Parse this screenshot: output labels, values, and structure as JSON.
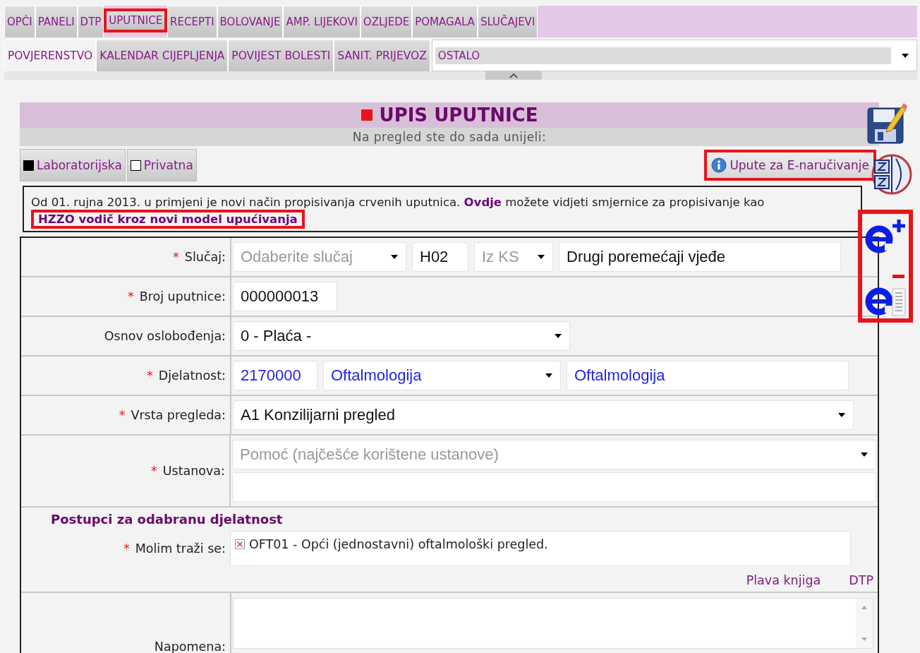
{
  "tabs_row_1": [
    {
      "label": "OPĆI",
      "selected": false,
      "highlighted": false
    },
    {
      "label": "PANELI",
      "selected": false,
      "highlighted": false
    },
    {
      "label": "DTP",
      "selected": false,
      "highlighted": false
    },
    {
      "label": "UPUTNICE",
      "selected": false,
      "highlighted": true
    },
    {
      "label": "RECEPTI",
      "selected": false,
      "highlighted": false
    },
    {
      "label": "BOLOVANJE",
      "selected": false,
      "highlighted": false
    },
    {
      "label": "AMP. LIJEKOVI",
      "selected": false,
      "highlighted": false
    },
    {
      "label": "OZLJEDE",
      "selected": false,
      "highlighted": false
    },
    {
      "label": "POMAGALA",
      "selected": false,
      "highlighted": false
    },
    {
      "label": "SLUČAJEVI",
      "selected": false,
      "highlighted": false
    }
  ],
  "tabs_row_2": [
    {
      "label": "POVJERENSTVO",
      "selected": true,
      "highlighted": false
    },
    {
      "label": "KALENDAR CIJEPLJENJA",
      "selected": false,
      "highlighted": false
    },
    {
      "label": "POVIJEST BOLESTI",
      "selected": false,
      "highlighted": false
    },
    {
      "label": "SANIT. PRIJEVOZ",
      "selected": false,
      "highlighted": false
    }
  ],
  "more_menu": {
    "value": "OSTALO"
  },
  "form": {
    "title": "UPIS UPUTNICE",
    "subtitle": "Na pregled ste do sada unijeli:"
  },
  "checkboxes": [
    {
      "label": "Laboratorijska",
      "checked": true
    },
    {
      "label": "Privatna",
      "checked": false
    }
  ],
  "info_button": {
    "label": "Upute za E-naručivanje",
    "highlighted": true
  },
  "notice": {
    "text_1": "Od 01. rujna 2013. u primjeni je novi način propisivanja crvenih uputnica.",
    "link_1": "Ovdje",
    "text_2": "možete vidjeti smjernice za propisivanje kao",
    "link_2": {
      "label": "HZZO vodič kroz novi model upućivanja",
      "highlighted": true
    }
  },
  "fields": [
    {
      "label": "Slučaj:",
      "required_mark": "*",
      "controls": [
        {
          "kind": "select",
          "placeholder": "Odaberite slučaj"
        },
        {
          "kind": "input",
          "value": "H02"
        },
        {
          "kind": "select",
          "placeholder": "Iz KS"
        },
        {
          "kind": "input",
          "value": "Drugi poremećaji vjeđe"
        }
      ]
    },
    {
      "label": "Broj uputnice:",
      "required_mark": "*",
      "controls": [
        {
          "kind": "input",
          "value": "000000013"
        }
      ]
    },
    {
      "label": "Osnov oslobođenja:",
      "controls": [
        {
          "kind": "select",
          "value": "0 - Plaća  -"
        }
      ]
    },
    {
      "label": "Djelatnost:",
      "required_mark": "*",
      "controls": [
        {
          "kind": "input",
          "value": "2170000",
          "autofilled": true
        },
        {
          "kind": "select",
          "value": "Oftalmologija",
          "autofilled": true
        },
        {
          "kind": "input",
          "value": "Oftalmologija",
          "autofilled": true
        }
      ]
    },
    {
      "label": "Vrsta pregleda:",
      "required_mark": "*",
      "controls": [
        {
          "kind": "select",
          "value": "A1 Konzilijarni pregled"
        }
      ]
    },
    {
      "label": "Ustanova:",
      "required_mark": "*",
      "controls": [
        {
          "kind": "select",
          "placeholder": "Pomoć (najčešće korištene ustanove)"
        },
        {
          "kind": "input"
        }
      ]
    }
  ],
  "procedures": {
    "heading": "Postupci za odabranu djelatnost",
    "label": "Molim traži se:",
    "required_mark": "*",
    "items": [
      "OFT01 - Opći (jednostavni) oftalmološki pregled."
    ],
    "links": [
      "Plava knjiga",
      "DTP"
    ]
  },
  "note": {
    "label": "Napomena:"
  },
  "side_icons": {
    "highlighted": true
  }
}
